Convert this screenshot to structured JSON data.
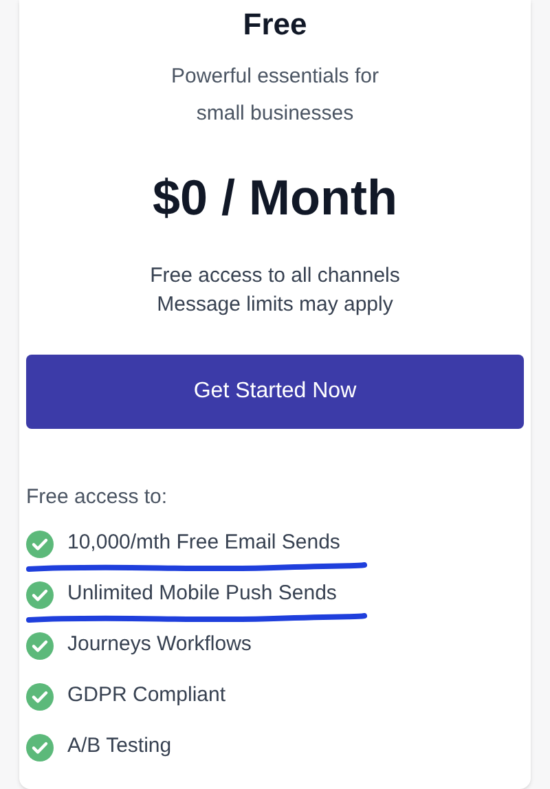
{
  "plan": {
    "name": "Free",
    "subtitle_lines": [
      "Powerful essentials for",
      "small businesses"
    ],
    "price": "$0 / Month",
    "notes": [
      "Free access to all channels",
      "Message limits may apply"
    ],
    "button": "Get Started Now",
    "features_heading": "Free access to:",
    "features": [
      {
        "label": "10,000/mth Free Email Sends",
        "underlined": true
      },
      {
        "label": "Unlimited Mobile Push Sends",
        "underlined": true
      },
      {
        "label": "Journeys Workflows",
        "underlined": false
      },
      {
        "label": "GDPR Compliant",
        "underlined": false
      },
      {
        "label": "A/B Testing",
        "underlined": false
      }
    ]
  }
}
